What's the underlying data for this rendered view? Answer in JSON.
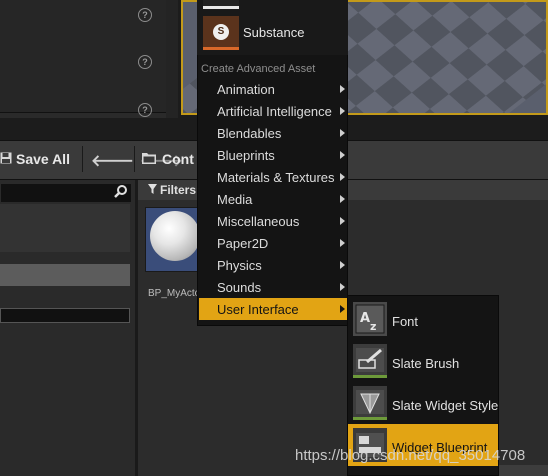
{
  "toolbar": {
    "save_all_label": "Save All",
    "content_label": "Cont"
  },
  "content_browser": {
    "filters_label": "Filters",
    "asset_label": "BP_MyActor"
  },
  "context_menu": {
    "substance_label": "Substance",
    "section_header": "Create Advanced Asset",
    "items": [
      {
        "label": "Animation"
      },
      {
        "label": "Artificial Intelligence"
      },
      {
        "label": "Blendables"
      },
      {
        "label": "Blueprints"
      },
      {
        "label": "Materials & Textures"
      },
      {
        "label": "Media"
      },
      {
        "label": "Miscellaneous"
      },
      {
        "label": "Paper2D"
      },
      {
        "label": "Physics"
      },
      {
        "label": "Sounds"
      },
      {
        "label": "User Interface"
      }
    ],
    "selected_item": "User Interface"
  },
  "submenu": {
    "items": [
      {
        "label": "Font",
        "icon": "font-icon"
      },
      {
        "label": "Slate Brush",
        "icon": "slate-brush-icon"
      },
      {
        "label": "Slate Widget Style",
        "icon": "slate-widget-style-icon"
      },
      {
        "label": "Widget Blueprint",
        "icon": "widget-blueprint-icon"
      }
    ],
    "selected_item": "Widget Blueprint"
  },
  "watermark": "https://blog.csdn.net/qq_35014708",
  "colors": {
    "accent": "#e2a414",
    "viewport_frame": "#c8a12a",
    "substance": "#d9692a"
  }
}
